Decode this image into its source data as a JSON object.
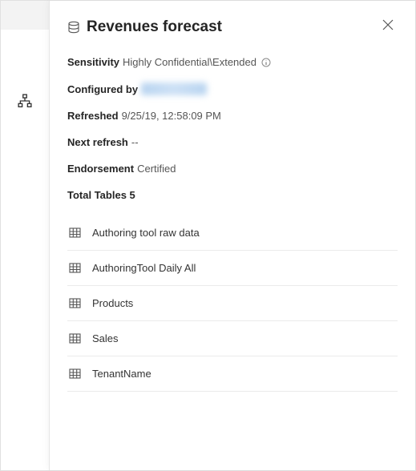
{
  "panel": {
    "title": "Revenues forecast",
    "sensitivity_label": "Sensitivity",
    "sensitivity_value": "Highly Confidential\\Extended",
    "configured_by_label": "Configured by",
    "refreshed_label": "Refreshed",
    "refreshed_value": "9/25/19, 12:58:09 PM",
    "next_refresh_label": "Next refresh",
    "next_refresh_value": "--",
    "endorsement_label": "Endorsement",
    "endorsement_value": "Certified",
    "total_tables_label": "Total Tables",
    "total_tables_count": "5"
  },
  "tables": [
    {
      "name": "Authoring tool raw data"
    },
    {
      "name": "AuthoringTool Daily All"
    },
    {
      "name": "Products"
    },
    {
      "name": "Sales"
    },
    {
      "name": "TenantName"
    }
  ]
}
